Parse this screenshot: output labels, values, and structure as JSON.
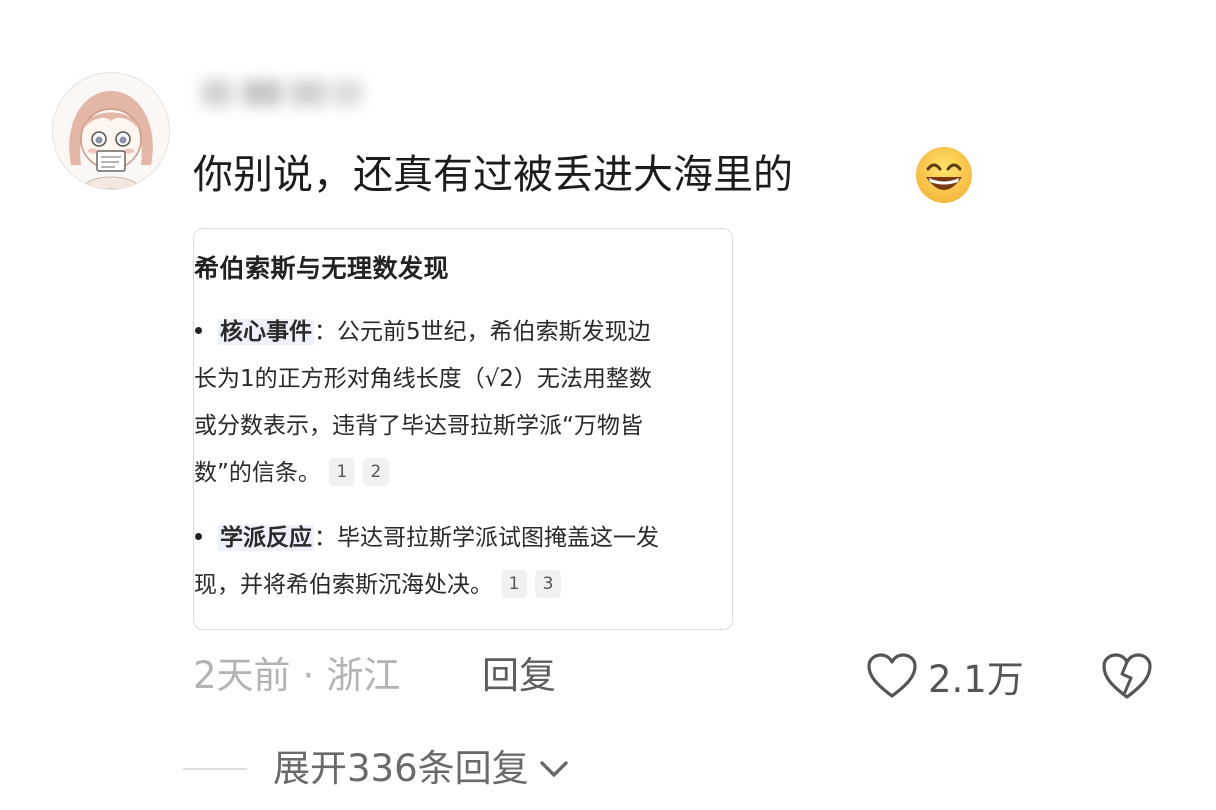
{
  "comment": {
    "text": "你别说，还真有过被丢进大海里的",
    "emoji_icon": "grinning-face-icon"
  },
  "card": {
    "title": "希伯索斯与无理数发现",
    "bullets": [
      {
        "term": "核心事件",
        "lines": [
          "：公元前5世纪，希伯索斯发现边",
          "长为1的正方形对角线长度（√2）无法用整数",
          "或分数表示，违背了毕达哥拉斯学派“万物皆",
          "数”的信条。"
        ],
        "citations": [
          "1",
          "2"
        ]
      },
      {
        "term": "学派反应",
        "lines": [
          "：毕达哥拉斯学派试图掩盖这一发",
          "现，并将希伯索斯沉海处决。"
        ],
        "citations": [
          "1",
          "3"
        ]
      }
    ]
  },
  "meta": {
    "time": "2天前",
    "separator": "·",
    "location": "浙江",
    "reply_label": "回复",
    "like_count": "2.1万"
  },
  "expand": {
    "label": "展开336条回复"
  },
  "colors": {
    "text": "#1c1c1c",
    "muted": "#b3b3b3",
    "action": "#5d5d5d",
    "term_highlight": "#eef0fb"
  }
}
